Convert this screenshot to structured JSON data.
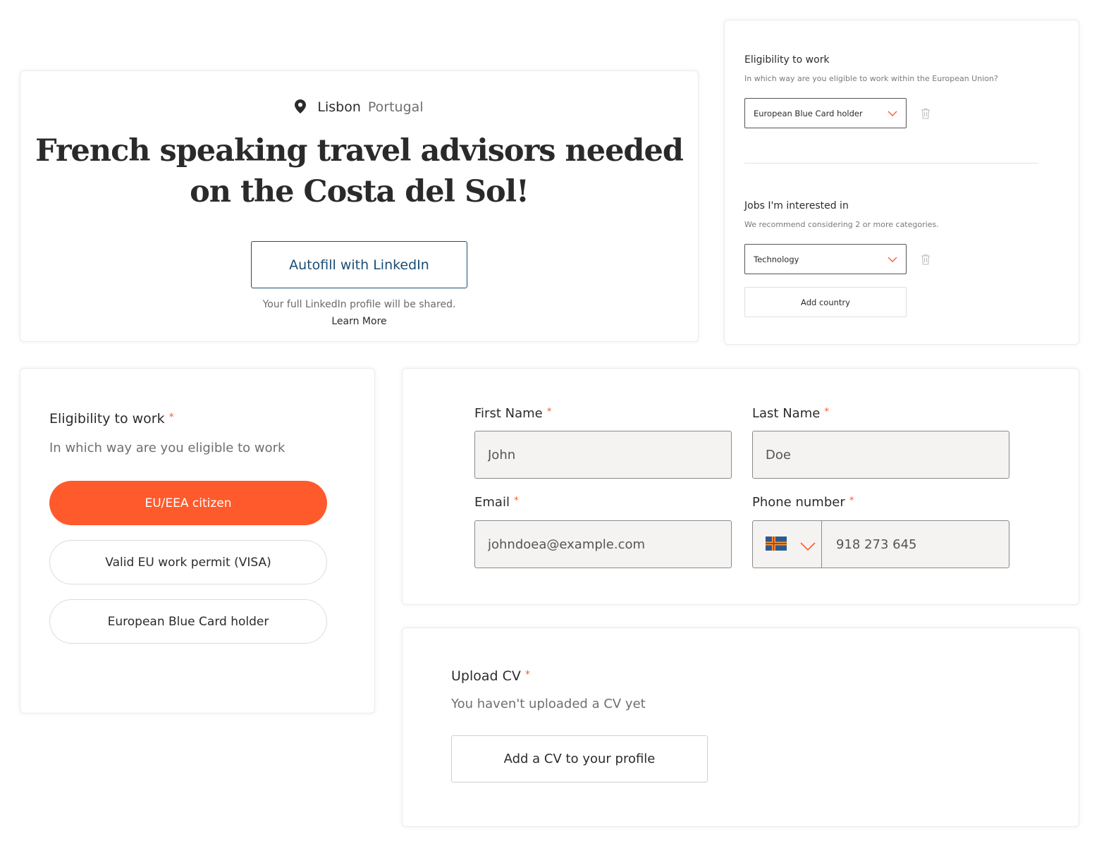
{
  "job": {
    "city": "Lisbon",
    "country": "Portugal",
    "title": "French speaking travel advisors needed on the Costa del Sol!",
    "autofill_label": "Autofill with LinkedIn",
    "autofill_note": "Your full LinkedIn profile will be shared.",
    "learn_more": "Learn More"
  },
  "eligibility_compact": {
    "label": "Eligibility to work",
    "sub": "In which way are you eligible to work within the European Union?",
    "selected": "European Blue Card holder"
  },
  "jobs_interest": {
    "label": "Jobs I'm interested in",
    "sub": "We recommend considering 2 or more categories.",
    "selected": "Technology",
    "add_label": "Add country"
  },
  "eligibility": {
    "label": "Eligibility to work",
    "required": "*",
    "sub": "In which way are you eligible to work",
    "options": [
      "EU/EEA citizen",
      "Valid EU work permit (VISA)",
      "European Blue Card holder"
    ],
    "selected_index": 0
  },
  "contact": {
    "first_name_label": "First Name",
    "first_name_value": "John",
    "last_name_label": "Last Name",
    "last_name_value": "Doe",
    "email_label": "Email",
    "email_value": "johndoea@example.com",
    "phone_label": "Phone number",
    "phone_value": "918 273 645",
    "required": "*"
  },
  "cv": {
    "label": "Upload CV",
    "required": "*",
    "sub": "You haven't uploaded a CV yet",
    "button": "Add a CV to your profile"
  },
  "colors": {
    "accent": "#ff5a2c",
    "linkedin_blue": "#1b4d75",
    "input_bg": "#f4f3f2"
  },
  "icons": {
    "location": "map-pin-icon",
    "dropdown": "chevron-down-icon",
    "delete": "trash-icon",
    "flag": "flag-icon"
  }
}
